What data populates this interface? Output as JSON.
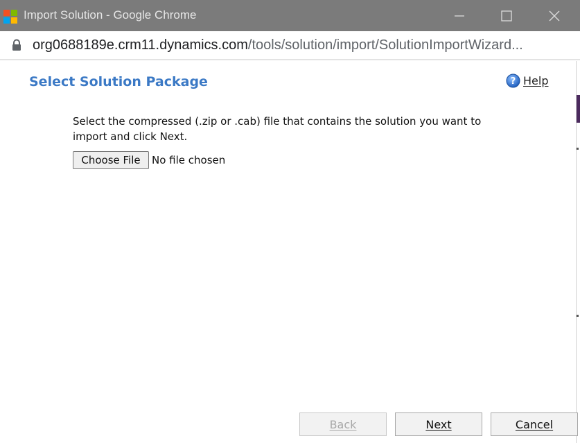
{
  "window": {
    "title": "Import Solution - Google Chrome"
  },
  "address_bar": {
    "domain": "org0688189e.crm11.dynamics.com",
    "path": "/tools/solution/import/SolutionImportWizard..."
  },
  "page": {
    "heading": "Select Solution Package",
    "help_label": "Help",
    "instructions": "Select the compressed (.zip or .cab) file that contains the solution you want to import and click Next.",
    "file_input": {
      "button_label": "Choose File",
      "status": "No file chosen"
    }
  },
  "footer": {
    "back_label": "Back",
    "next_label": "Next",
    "cancel_label": "Cancel",
    "back_enabled": false
  },
  "icons": {
    "app_logo": "microsoft-logo-icon",
    "lock": "lock-icon",
    "help": "help-question-icon",
    "minimize": "minimize-icon",
    "maximize": "maximize-icon",
    "close": "close-icon"
  },
  "colors": {
    "heading": "#3b79c5",
    "titlebar": "#7b7b7b",
    "help_icon": "#2f6fc9"
  }
}
